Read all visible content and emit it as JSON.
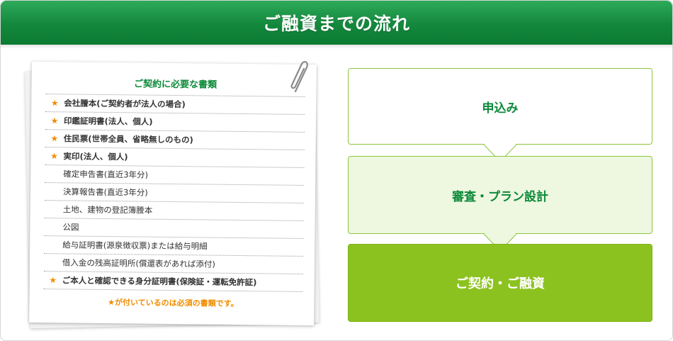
{
  "header": {
    "title": "ご融資までの流れ"
  },
  "documents": {
    "title": "ご契約に必要な書類",
    "items": [
      {
        "label": "会社謄本(ご契約者が法人の場合)",
        "star": "★",
        "required": true
      },
      {
        "label": "印鑑証明書(法人、個人)",
        "star": "★",
        "required": true
      },
      {
        "label": "住民票(世帯全員、省略無しのもの)",
        "star": "★",
        "required": true
      },
      {
        "label": "実印(法人、個人)",
        "star": "★",
        "required": true
      },
      {
        "label": "確定申告書(直近3年分)",
        "star": "",
        "required": false
      },
      {
        "label": "決算報告書(直近3年分)",
        "star": "",
        "required": false
      },
      {
        "label": "土地、建物の登記簿謄本",
        "star": "",
        "required": false
      },
      {
        "label": "公図",
        "star": "",
        "required": false
      },
      {
        "label": "給与証明書(源泉徴収票)または給与明細",
        "star": "",
        "required": false
      },
      {
        "label": "借入金の残高証明所(償還表があれば添付)",
        "star": "",
        "required": false
      },
      {
        "label": "ご本人と確認できる身分証明書(保険証・運転免許証)",
        "star": "★",
        "required": true
      }
    ],
    "note": "★が付いているのは必須の書類です。"
  },
  "flow": {
    "steps": [
      {
        "label": "申込み"
      },
      {
        "label": "審査・プラン設計"
      },
      {
        "label": "ご契約・ご融資"
      }
    ]
  },
  "colors": {
    "header_green": "#13883c",
    "title_green": "#0d8a3a",
    "star_orange": "#f08c00",
    "step_border": "#8dc63f",
    "step2_bg": "#eef7df",
    "step3_bg": "#8cc21f"
  }
}
